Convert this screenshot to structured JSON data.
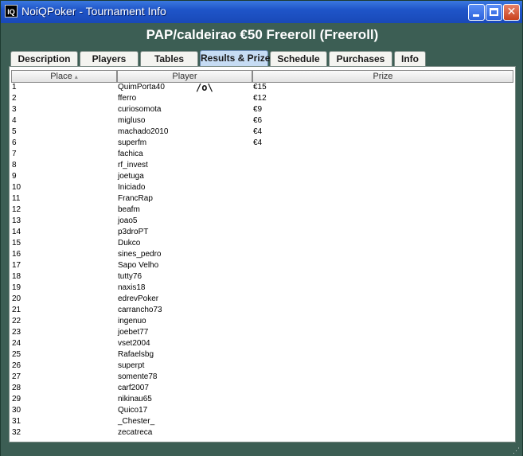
{
  "window": {
    "title": "NoiQPoker - Tournament Info",
    "app_icon_text": "IQ"
  },
  "heading": "PAP/caldeirao €50 Freeroll (Freeroll)",
  "tabs": [
    {
      "label": "Description"
    },
    {
      "label": "Players"
    },
    {
      "label": "Tables"
    },
    {
      "label": "Results & Prizes",
      "active": true
    },
    {
      "label": "Schedule"
    },
    {
      "label": "Purchases"
    },
    {
      "label": "Info"
    }
  ],
  "table": {
    "columns": {
      "place": "Place",
      "player": "Player",
      "prize": "Prize"
    },
    "sort_indicator": "▴",
    "annotation": "/o\\",
    "rows": [
      {
        "place": "1",
        "player": "QuimPorta40",
        "prize": "€15"
      },
      {
        "place": "2",
        "player": "fferro",
        "prize": "€12"
      },
      {
        "place": "3",
        "player": "curiosomota",
        "prize": "€9"
      },
      {
        "place": "4",
        "player": "migluso",
        "prize": "€6"
      },
      {
        "place": "5",
        "player": "machado2010",
        "prize": "€4"
      },
      {
        "place": "6",
        "player": "superfm",
        "prize": "€4"
      },
      {
        "place": "7",
        "player": "fachica",
        "prize": ""
      },
      {
        "place": "8",
        "player": "rf_invest",
        "prize": ""
      },
      {
        "place": "9",
        "player": "joetuga",
        "prize": ""
      },
      {
        "place": "10",
        "player": "Iniciado",
        "prize": ""
      },
      {
        "place": "11",
        "player": "FrancRap",
        "prize": ""
      },
      {
        "place": "12",
        "player": "beafm",
        "prize": ""
      },
      {
        "place": "13",
        "player": "joao5",
        "prize": ""
      },
      {
        "place": "14",
        "player": "p3droPT",
        "prize": ""
      },
      {
        "place": "15",
        "player": "Dukco",
        "prize": ""
      },
      {
        "place": "16",
        "player": "sines_pedro",
        "prize": ""
      },
      {
        "place": "17",
        "player": "Sapo Velho",
        "prize": ""
      },
      {
        "place": "18",
        "player": "tutty76",
        "prize": ""
      },
      {
        "place": "19",
        "player": "naxis18",
        "prize": ""
      },
      {
        "place": "20",
        "player": "edrevPoker",
        "prize": ""
      },
      {
        "place": "21",
        "player": "carrancho73",
        "prize": ""
      },
      {
        "place": "22",
        "player": "ingenuo",
        "prize": ""
      },
      {
        "place": "23",
        "player": "joebet77",
        "prize": ""
      },
      {
        "place": "24",
        "player": "vset2004",
        "prize": ""
      },
      {
        "place": "25",
        "player": "Rafaelsbg",
        "prize": ""
      },
      {
        "place": "26",
        "player": "superpt",
        "prize": ""
      },
      {
        "place": "27",
        "player": "somente78",
        "prize": ""
      },
      {
        "place": "28",
        "player": "carf2007",
        "prize": ""
      },
      {
        "place": "29",
        "player": "nikinau65",
        "prize": ""
      },
      {
        "place": "30",
        "player": "Quico17",
        "prize": ""
      },
      {
        "place": "31",
        "player": "_Chester_",
        "prize": ""
      },
      {
        "place": "32",
        "player": "zecatreca",
        "prize": ""
      }
    ]
  },
  "icons": {
    "app": "app-logo-icon",
    "minimize": "minimize-icon",
    "maximize": "maximize-icon",
    "close": "close-icon",
    "sort": "sort-ascending-icon",
    "resize": "resize-grip-icon"
  },
  "colors": {
    "window_background": "#3c5e54",
    "titlebar": "#1f55c8",
    "active_tab": "#c6dcf4",
    "close_button": "#c8421e"
  }
}
